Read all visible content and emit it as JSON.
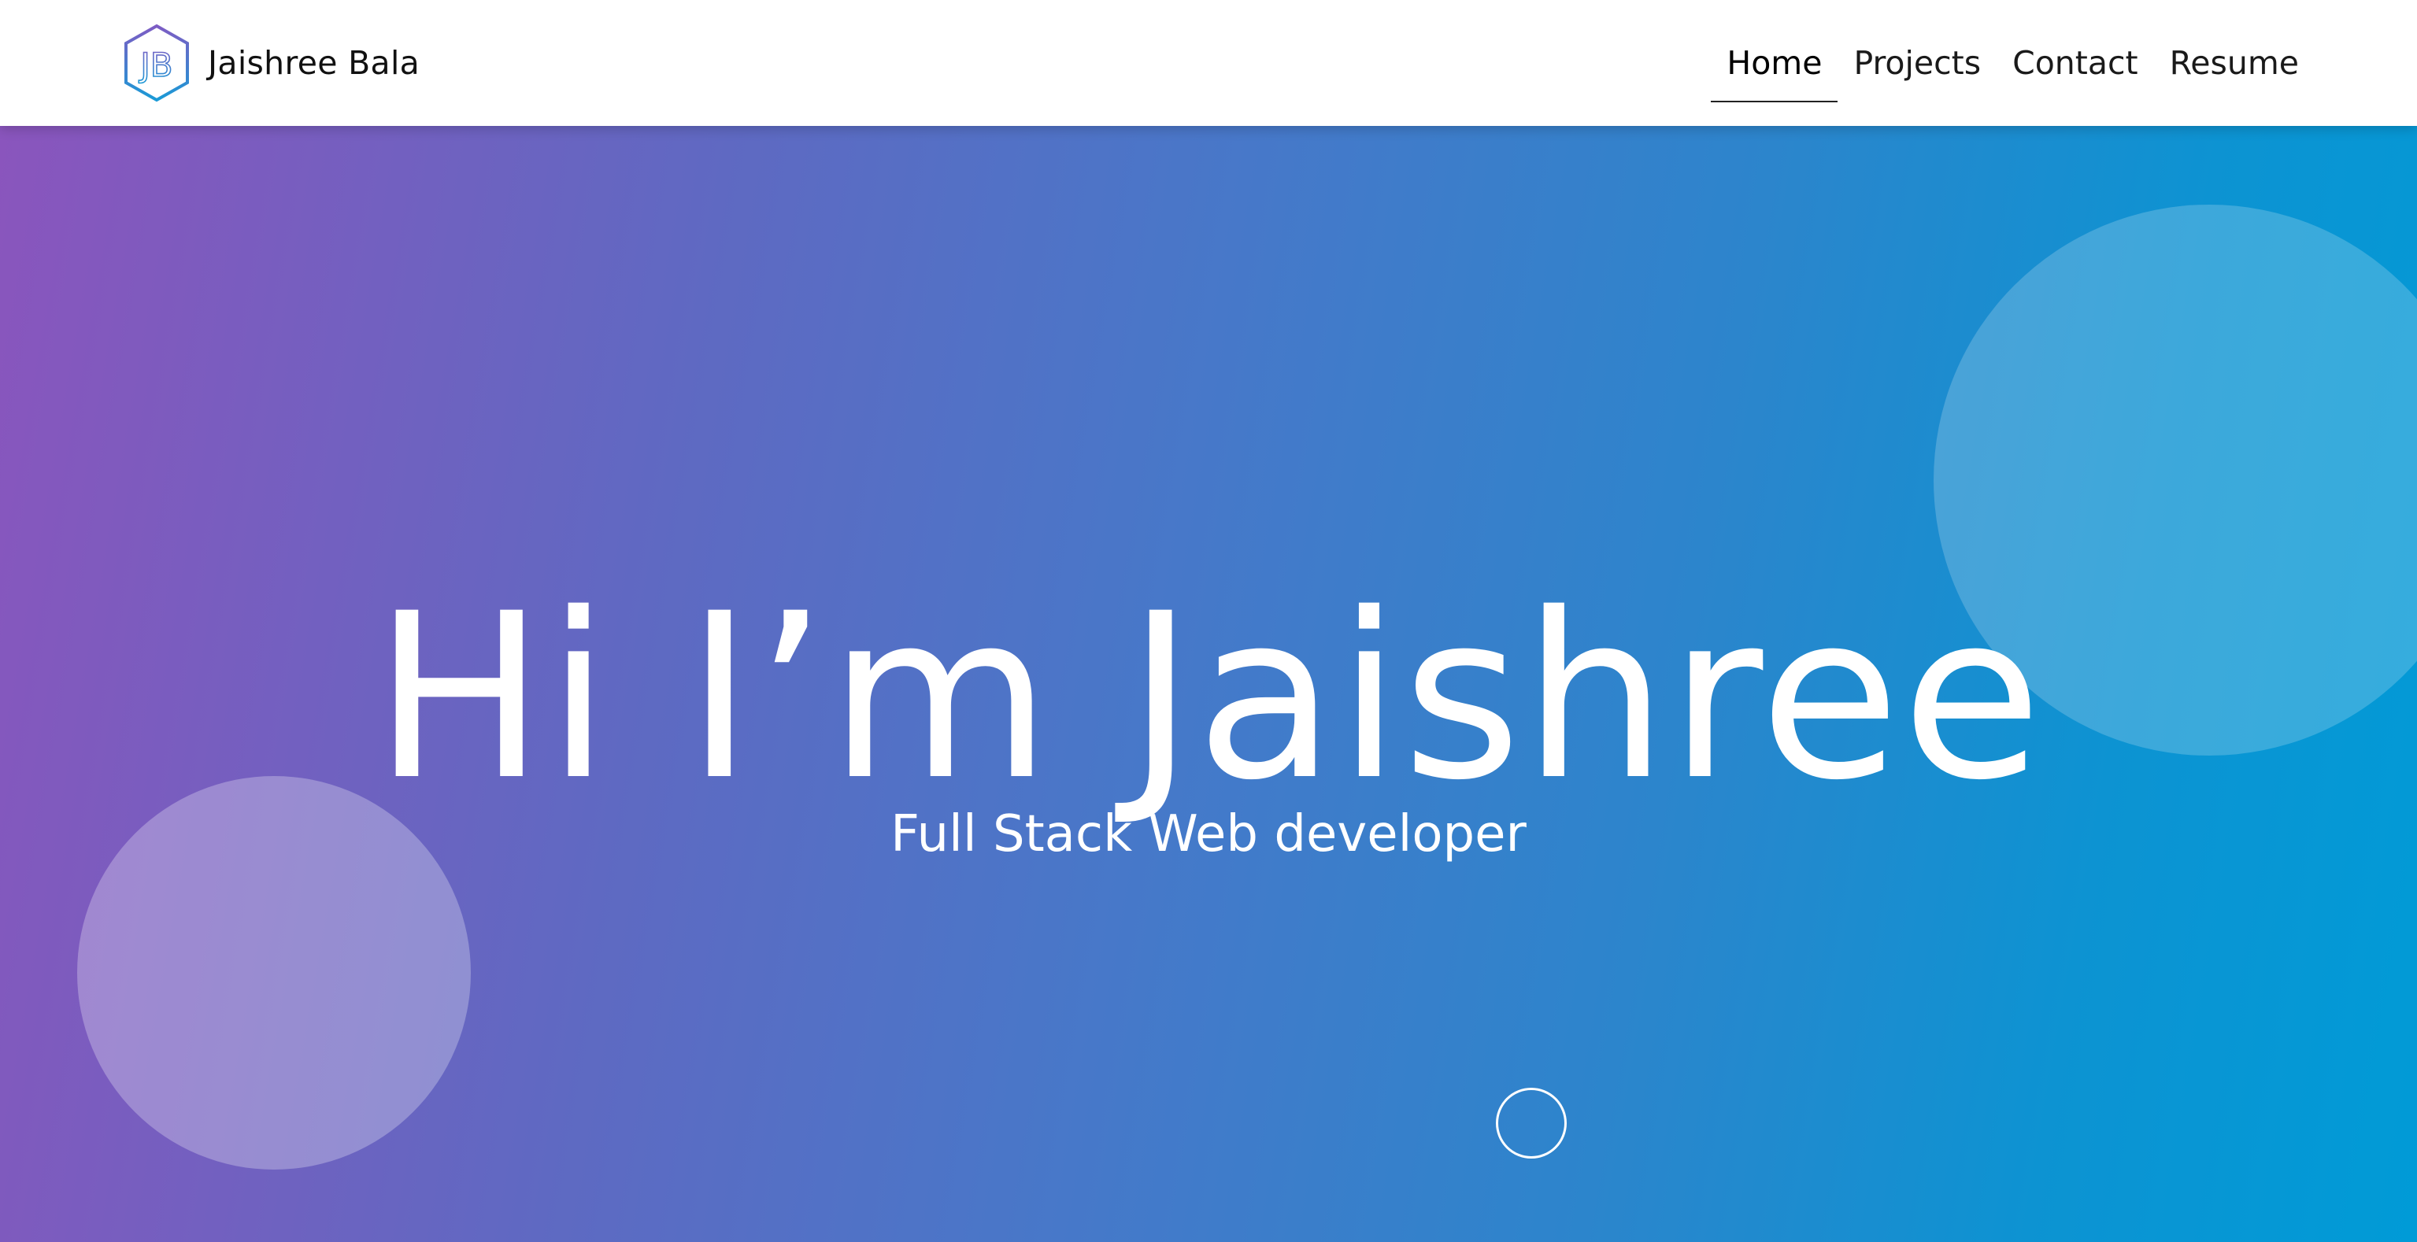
{
  "header": {
    "logo_monogram": "JB",
    "brand_name": "Jaishree Bala"
  },
  "nav": {
    "items": [
      {
        "label": "Home",
        "active": true
      },
      {
        "label": "Projects",
        "active": false
      },
      {
        "label": "Contact",
        "active": false
      },
      {
        "label": "Resume",
        "active": false
      }
    ]
  },
  "hero": {
    "title": "Hi I’m Jaishree",
    "subtitle": "Full Stack Web developer"
  },
  "colors": {
    "gradient_start": "#8a55bd",
    "gradient_end": "#009bd7",
    "logo_stroke_start": "#7d5cc4",
    "logo_stroke_end": "#1a9ad6"
  },
  "icons": {
    "logo": "hexagon-monogram-icon",
    "scroll": "scroll-circle-icon"
  }
}
